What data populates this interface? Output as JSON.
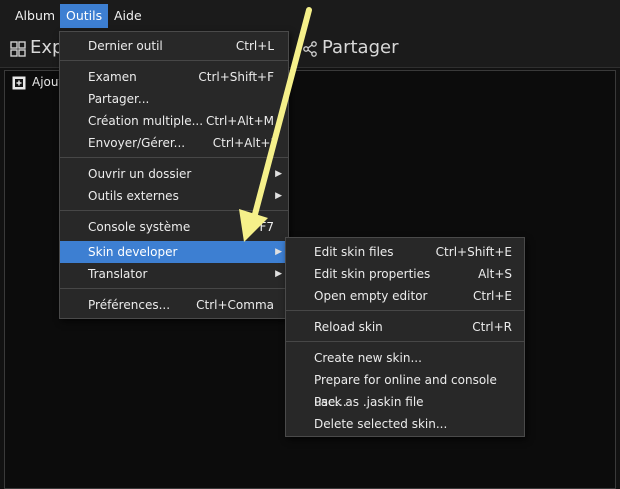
{
  "menubar": {
    "items": [
      {
        "label": "Album"
      },
      {
        "label": "Outils"
      },
      {
        "label": "Aide"
      }
    ]
  },
  "toolbar": {
    "left_label": "Exp",
    "right_label": "Partager"
  },
  "panel": {
    "add_label": "Ajout"
  },
  "outils_menu": {
    "items": [
      {
        "label": "Dernier outil",
        "shortcut": "Ctrl+L"
      },
      {
        "label": "Examen",
        "shortcut": "Ctrl+Shift+F"
      },
      {
        "label": "Partager...",
        "shortcut": ""
      },
      {
        "label": "Création multiple...",
        "shortcut": "Ctrl+Alt+M"
      },
      {
        "label": "Envoyer/Gérer...",
        "shortcut": "Ctrl+Alt+I"
      },
      {
        "label": "Ouvrir un dossier",
        "shortcut": ""
      },
      {
        "label": "Outils externes",
        "shortcut": ""
      },
      {
        "label": "Console système",
        "shortcut": "F7"
      },
      {
        "label": "Skin developer",
        "shortcut": ""
      },
      {
        "label": "Translator",
        "shortcut": ""
      },
      {
        "label": "Préférences...",
        "shortcut": "Ctrl+Comma"
      }
    ]
  },
  "skin_menu": {
    "items": [
      {
        "label": "Edit skin files",
        "shortcut": "Ctrl+Shift+E"
      },
      {
        "label": "Edit skin properties",
        "shortcut": "Alt+S"
      },
      {
        "label": "Open empty editor",
        "shortcut": "Ctrl+E"
      },
      {
        "label": "Reload skin",
        "shortcut": "Ctrl+R"
      },
      {
        "label": "Create new skin...",
        "shortcut": ""
      },
      {
        "label": "Prepare for online and console use...",
        "shortcut": ""
      },
      {
        "label": "Pack as .jaskin file",
        "shortcut": ""
      },
      {
        "label": "Delete selected skin...",
        "shortcut": ""
      }
    ]
  },
  "annotation": {
    "arrow_color": "#f5f08a"
  },
  "colors": {
    "highlight": "#3d7fd2",
    "menu_bg": "#282828",
    "background": "#121212"
  }
}
